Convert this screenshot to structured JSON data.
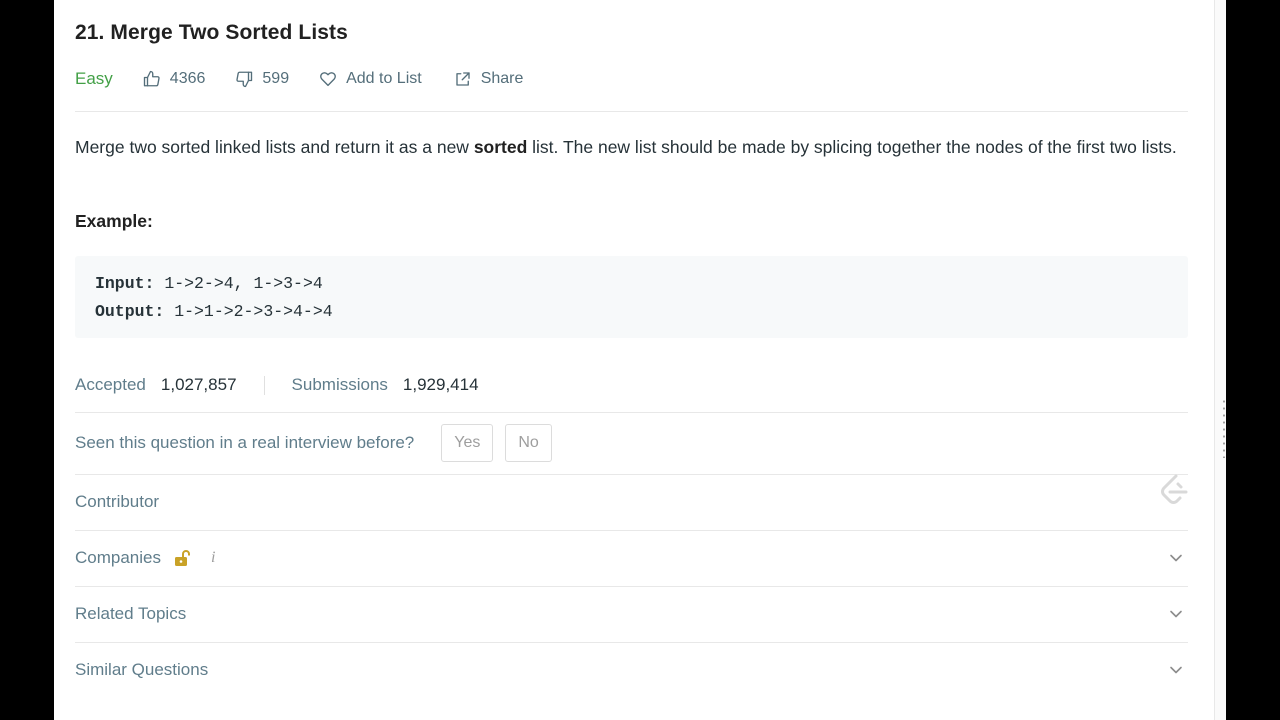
{
  "problem": {
    "title": "21. Merge Two Sorted Lists",
    "difficulty": "Easy",
    "likes": "4366",
    "dislikes": "599",
    "add_to_list_label": "Add to List",
    "share_label": "Share"
  },
  "description": {
    "before_bold": "Merge two sorted linked lists and return it as a new ",
    "bold": "sorted",
    "after_bold": " list. The new list should be made by splicing together the nodes of the first two lists."
  },
  "example": {
    "heading": "Example:",
    "input_label": "Input:",
    "input_value": " 1->2->4, 1->3->4",
    "output_label": "Output:",
    "output_value": " 1->1->2->3->4->4"
  },
  "stats": {
    "accepted_label": "Accepted",
    "accepted_value": "1,027,857",
    "submissions_label": "Submissions",
    "submissions_value": "1,929,414"
  },
  "interview": {
    "question": "Seen this question in a real interview before?",
    "yes_label": "Yes",
    "no_label": "No"
  },
  "sections": {
    "contributor": "Contributor",
    "companies": "Companies",
    "companies_info": "i",
    "related_topics": "Related Topics",
    "similar_questions": "Similar Questions"
  },
  "colors": {
    "difficulty_easy": "#43a047",
    "lock": "#c9a227",
    "page_background": "#000000"
  },
  "icons": {
    "like": "thumbs-up-icon",
    "dislike": "thumbs-down-icon",
    "add_to_list": "heart-icon",
    "share": "share-icon",
    "companies_lock": "unlock-icon",
    "expand": "chevron-down-icon",
    "contributor": "leetcode-logo"
  }
}
